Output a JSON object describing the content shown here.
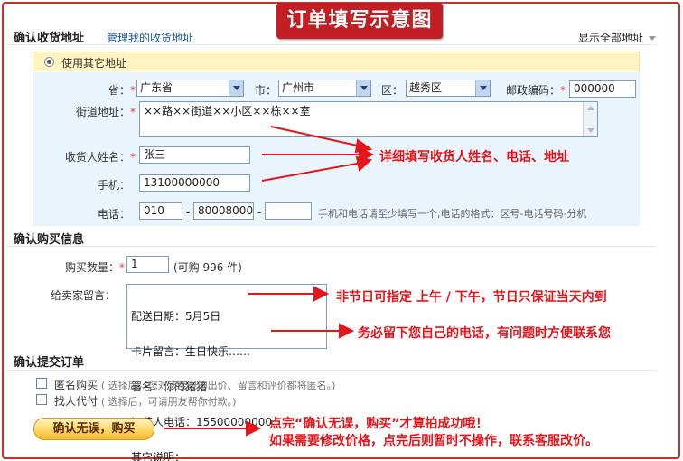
{
  "banner": "订单填写示意图",
  "address_section": {
    "title": "确认收货地址",
    "manage_link": "管理我的收货地址",
    "show_all": "显示全部地址",
    "use_other": "使用其它地址",
    "province_label": "省：",
    "province_value": "广东省",
    "city_label": "市：",
    "city_value": "广州市",
    "district_label": "区：",
    "district_value": "越秀区",
    "postcode_label": "邮政编码：",
    "postcode_value": "000000",
    "street_label": "街道地址：",
    "street_value": "××路××街道××小区××栋××室",
    "name_label": "收货人姓名：",
    "name_value": "张三",
    "mobile_label": "手机：",
    "mobile_value": "13100000000",
    "phone_label": "电话：",
    "phone_area": "010",
    "phone_number": "80008000",
    "phone_ext": "",
    "phone_dash1": "-",
    "phone_dash2": "-",
    "phone_hint": "手机和电话请至少填写一个,电话的格式：区号-电话号码-分机"
  },
  "purchase_section": {
    "title": "确认购买信息",
    "qty_label": "购买数量：",
    "qty_value": "1",
    "qty_hint": "(可购 996 件)",
    "message_label": "给卖家留言：",
    "message_lines": [
      "配送日期：5月5日",
      "卡片留言：生日快乐……",
      "署名：你的猪猪",
      "订花人电话：15500000000",
      "其它说明："
    ]
  },
  "submit_section": {
    "title": "确认提交订单",
    "anonymous_label": "匿名购买",
    "anonymous_hint": "( 选择后，您对该宝贝的出价、留言和评价都将匿名。)",
    "proxy_label": "找人代付",
    "proxy_hint": "( 选择后，可请朋友帮你付款。)",
    "submit_button": "确认无误，购买"
  },
  "required_mark": "*",
  "annotations": {
    "fill_info": "详细填写收货人姓名、电话、地址",
    "delivery": "非节日可指定  上午 / 下午，节日只保证当天内到",
    "phone_note": "务必留下您自己的电话，有问题时方便联系您",
    "confirm_line1": "点完“确认无误，购买”才算拍成功哦！",
    "confirm_line2": "如果需要修改价格，点完后则暂时不操作，联系客服改价。"
  },
  "colors": {
    "accent_red": "#e4151b",
    "banner_red": "#c21f25",
    "link_blue": "#1e5494",
    "panel_blue": "#eaf4fd",
    "highlight_yellow": "#fff4c2"
  }
}
